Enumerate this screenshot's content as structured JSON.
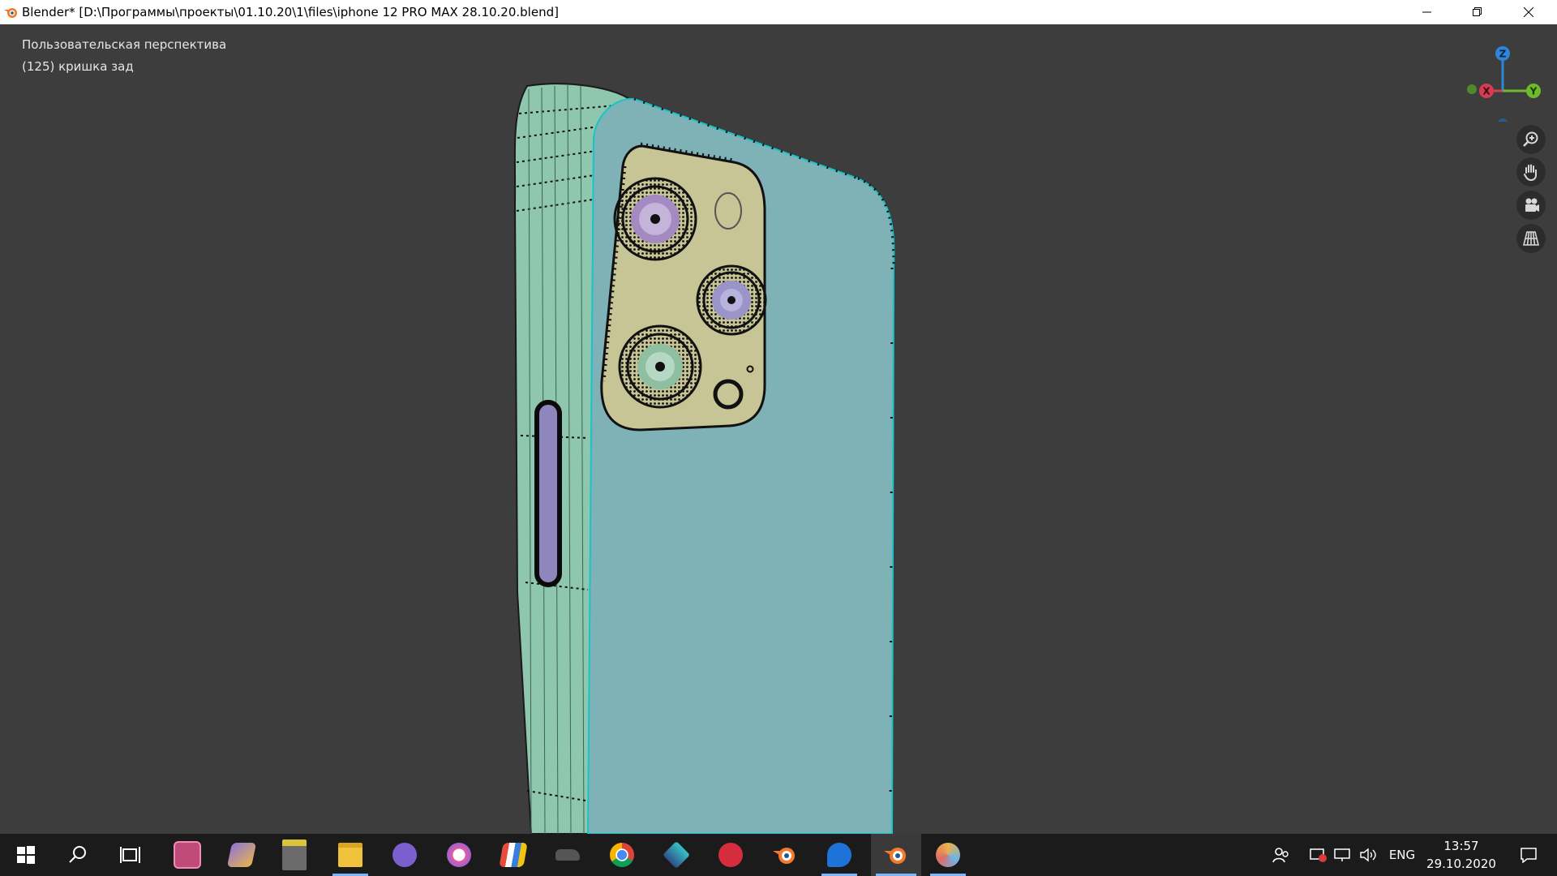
{
  "window": {
    "title": "Blender* [D:\\Программы\\проекты\\01.10.20\\1\\files\\iphone 12 PRO MAX 28.10.20.blend]",
    "controls": [
      "minimize-icon",
      "maximize-icon",
      "close-icon"
    ]
  },
  "viewport": {
    "view_name": "Пользовательская перспектива",
    "object_info": "(125) кришка зад",
    "gizmo": {
      "x": "X",
      "y": "Y",
      "z": "Z"
    },
    "nav_buttons": [
      "zoom-icon",
      "hand-pan-icon",
      "camera-icon",
      "perspective-grid-icon"
    ],
    "colors": {
      "background": "#3d3d3d",
      "phone_back": "#7fb2b7",
      "phone_side": "#8fc6ae",
      "camera_bump": "#c7c495",
      "button_purple": "#8e86bd"
    }
  },
  "taskbar": {
    "apps": [
      "windows-start-icon",
      "search-icon",
      "task-view-icon",
      "app-pink-icon",
      "app-purple-icon",
      "app-monitor-icon",
      "file-explorer-icon",
      "viber-icon",
      "itunes-icon",
      "app-stack-icon",
      "app-car-icon",
      "chrome-icon",
      "app-layers-icon",
      "app-red-s-icon",
      "blender-icon",
      "edge-icon",
      "blender-active-icon",
      "paint-icon"
    ],
    "tray": {
      "icons": [
        "people-icon",
        "security-icon",
        "network-icon",
        "volume-icon"
      ],
      "language": "ENG",
      "time": "13:57",
      "date": "29.10.2020",
      "notifications_icon": "notification-icon"
    }
  }
}
